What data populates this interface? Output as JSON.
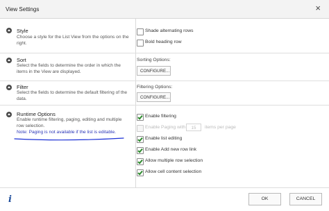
{
  "window": {
    "title": "View Settings",
    "close_symbol": "×"
  },
  "sections": {
    "style": {
      "title": "Style",
      "description": "Choose a style for the List View from the options on the right.",
      "options": {
        "shade_alternating_rows": {
          "label": "Shade alternating rows",
          "checked": false
        },
        "bold_heading_row": {
          "label": "Bold heading row",
          "checked": false
        }
      }
    },
    "sort": {
      "title": "Sort",
      "description": "Select the fields to determine the order in which the items in the View are displayed.",
      "options_label": "Sorting Options:",
      "configure_label": "CONFIGURE..."
    },
    "filter": {
      "title": "Filter",
      "description": "Select the fields to determine the default filtering of the data.",
      "options_label": "Filtering Options:",
      "configure_label": "CONFIGURE..."
    },
    "runtime": {
      "title": "Runtime Options",
      "description": "Enable runtime filtering, paging, editing and multiple row selection.",
      "note": "Note: Paging is not available if the list is editable.",
      "options": {
        "enable_filtering": {
          "label": "Enable filtering",
          "checked": true
        },
        "enable_paging": {
          "label": "Enable Paging with",
          "value": "15",
          "suffix": "items per page",
          "checked": false,
          "disabled": true
        },
        "enable_list_editing": {
          "label": "Enable list editing",
          "checked": true
        },
        "enable_add_new_row_link": {
          "label": "Enable Add new row link",
          "checked": true
        },
        "allow_multiple_row_selection": {
          "label": "Allow multiple row selection",
          "checked": true
        },
        "allow_cell_content_selection": {
          "label": "Allow cell content selection",
          "checked": true
        }
      }
    }
  },
  "footer": {
    "info_symbol": "i",
    "ok_label": "OK",
    "cancel_label": "CANCEL"
  },
  "colors": {
    "note_ink": "#2a35b8",
    "underline_ink": "#1a2fd6",
    "info_icon": "#1f4e9c",
    "check": "#2d8a2d"
  }
}
